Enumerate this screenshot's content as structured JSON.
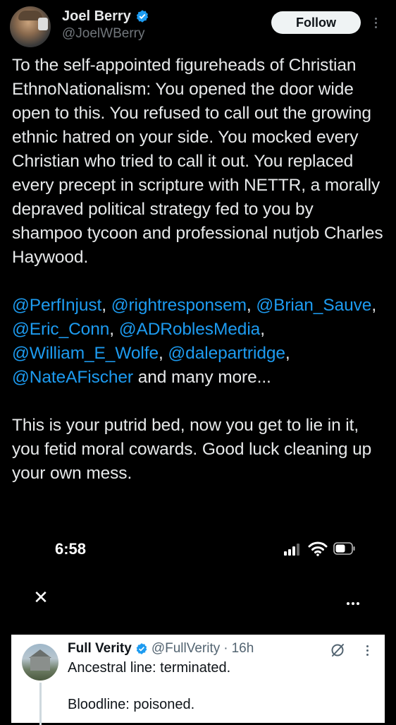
{
  "post": {
    "author_name": "Joel Berry",
    "author_handle": "@JoelWBerry",
    "follow_label": "Follow",
    "paragraph1": "To the self-appointed figureheads of Christian EthnoNationalism: You opened the door wide open to this. You refused to call out the growing ethnic hatred on your side. You mocked every Christian who tried to call it out. You replaced every precept in scripture with NETTR, a morally depraved political strategy fed to you by shampoo tycoon and professional nutjob Charles Haywood.",
    "mentions": [
      "@PerfInjust",
      "@rightresponsem",
      "@Brian_Sauve",
      "@Eric_Conn",
      "@ADRoblesMedia",
      "@William_E_Wolfe",
      "@dalepartridge",
      "@NateAFischer"
    ],
    "sep": ", ",
    "mentions_tail": " and many more...",
    "paragraph3": "This is your putrid bed, now you get to lie in it, you fetid moral cowards. Good luck cleaning up your own mess."
  },
  "status_bar": {
    "time": "6:58"
  },
  "nav": {
    "close_glyph": "✕"
  },
  "quoted": {
    "name": "Full Verity",
    "handle": "@FullVerity",
    "dot": "·",
    "age": "16h",
    "line1": "Ancestral line: terminated.",
    "line2": "Bloodline: poisoned."
  },
  "colors": {
    "background": "#000000",
    "text": "#e7e9ea",
    "mention": "#1d9bf0",
    "verified": "#1d9bf0"
  },
  "icons": {
    "verified": "verified-badge-icon",
    "more": "more-vertical-icon",
    "signal": "cellular-signal-icon",
    "wifi": "wifi-icon",
    "battery": "battery-icon",
    "close": "close-icon",
    "more_h": "more-horizontal-icon",
    "grok": "grok-icon"
  }
}
